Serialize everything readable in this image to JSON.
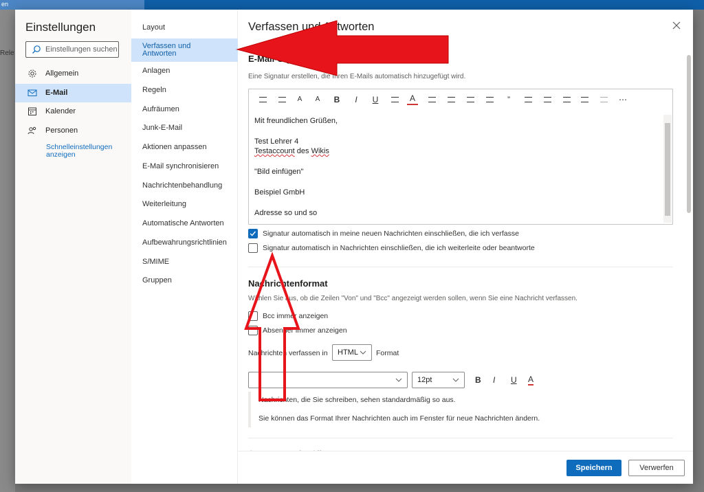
{
  "topbar": {
    "tab_label": "en"
  },
  "background": {
    "partial_label": "Rele"
  },
  "colors": {
    "accent": "#0f6cbd",
    "active_nav": "#cfe4fa",
    "arrow": "#e8141c"
  },
  "sidebar": {
    "title": "Einstellungen",
    "search_placeholder": "Einstellungen suchen",
    "items": [
      {
        "label": "Allgemein",
        "icon": "gear-icon"
      },
      {
        "label": "E-Mail",
        "icon": "mail-icon"
      },
      {
        "label": "Kalender",
        "icon": "calendar-icon"
      },
      {
        "label": "Personen",
        "icon": "people-icon"
      }
    ],
    "quick_settings": "Schnelleinstellungen anzeigen"
  },
  "subnav": {
    "items": [
      "Layout",
      "Verfassen und Antworten",
      "Anlagen",
      "Regeln",
      "Aufräumen",
      "Junk-E-Mail",
      "Aktionen anpassen",
      "E-Mail synchronisieren",
      "Nachrichtenbehandlung",
      "Weiterleitung",
      "Automatische Antworten",
      "Aufbewahrungsrichtlinien",
      "S/MIME",
      "Gruppen"
    ],
    "active_index": 1
  },
  "main": {
    "title": "Verfassen und Antworten",
    "signature": {
      "heading": "E-Mail-Signatur",
      "description": "Eine Signatur erstellen, die Ihren E-Mails automatisch hinzugefügt wird.",
      "toolbar_icons": [
        "insert-image-icon",
        "format-painter-icon",
        "font-size-icon",
        "superscript-icon",
        "bold-icon",
        "italic-icon",
        "underline-icon",
        "highlight-icon",
        "font-color-icon",
        "bullets-icon",
        "numbering-icon",
        "decrease-indent-icon",
        "increase-indent-icon",
        "quote-icon",
        "align-left-icon",
        "align-center-icon",
        "align-right-icon",
        "link-icon",
        "unlink-icon",
        "more-icon"
      ],
      "toolbar_glyphs": [
        "",
        "",
        "A",
        "A",
        "B",
        "I",
        "U",
        "",
        "A",
        "",
        "",
        "",
        "",
        "”",
        "",
        "",
        "",
        "",
        "",
        "⋯"
      ],
      "body_lines": [
        "Mit freundlichen Grüßen,",
        "",
        "Test Lehrer 4",
        "Testaccount des Wikis",
        "",
        "\"Bild einfügen\"",
        "",
        "Beispiel GmbH",
        "",
        "Adresse so und so"
      ],
      "line9_word1": "Testaccount",
      "line9_mid": " des ",
      "line9_word2": "Wikis",
      "checkbox_new": {
        "label": "Signatur automatisch in meine neuen Nachrichten einschließen, die ich verfasse",
        "checked": true
      },
      "checkbox_reply": {
        "label": "Signatur automatisch in Nachrichten einschließen, die ich weiterleite oder beantworte",
        "checked": false
      }
    },
    "message_format": {
      "heading": "Nachrichtenformat",
      "description": "Wählen Sie aus, ob die Zeilen \"Von\" und \"Bcc\" angezeigt werden sollen, wenn Sie eine Nachricht verfassen.",
      "bcc_label": "Bcc immer anzeigen",
      "from_label": "Absender immer anzeigen",
      "compose_prefix": "Nachrichten verfassen in",
      "compose_value": "HTML",
      "compose_suffix": "Format",
      "font_value": "",
      "size_value": "12pt",
      "fmt_buttons": [
        "B",
        "I",
        "U",
        "A"
      ],
      "preview_line1": "Nachrichten, die Sie schreiben, sehen standardmäßig so aus.",
      "preview_line2": "Sie können das Format Ihrer Nachrichten auch im Fenster für neue Nachrichten ändern."
    },
    "next_section_partial": "Antworten oder Allen antworten",
    "save": "Speichern",
    "discard": "Verwerfen"
  }
}
